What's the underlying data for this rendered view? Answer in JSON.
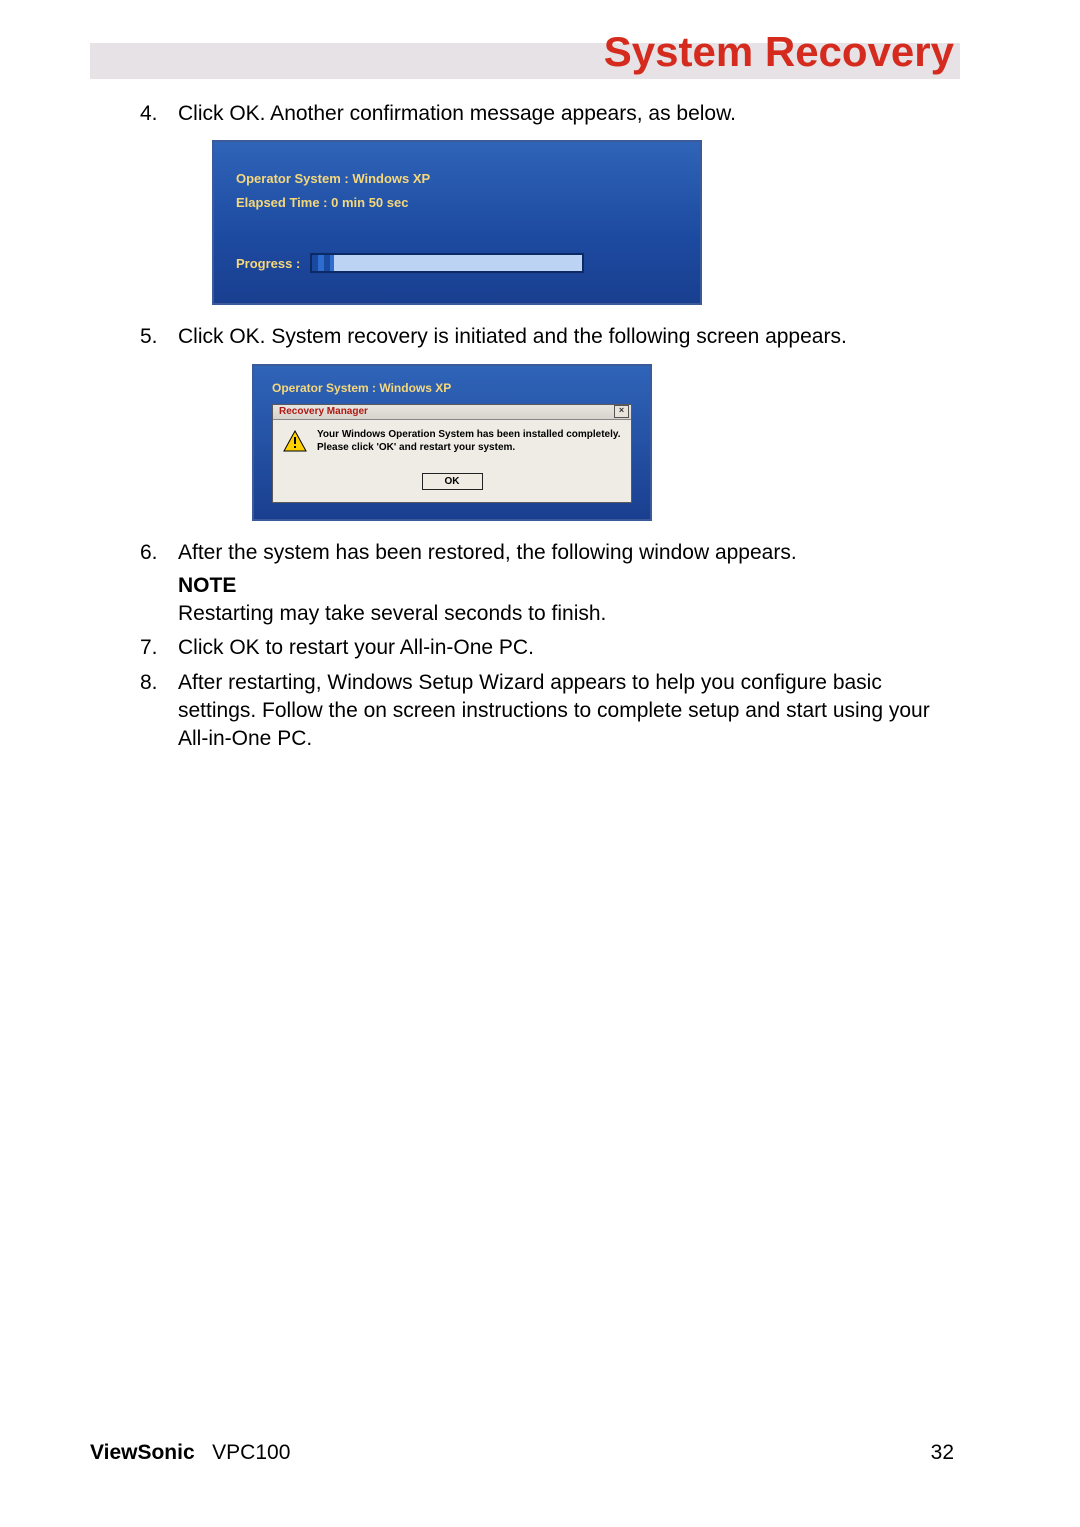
{
  "header": {
    "title": "System Recovery"
  },
  "steps": {
    "s4_num": "4.",
    "s4": "Click OK. Another confirmation message appears, as below.",
    "s5_num": "5.",
    "s5": "Click OK. System recovery is initiated and the following screen appears.",
    "s6_num": "6.",
    "s6": "After the system has been restored, the following window appears.",
    "note_label": "NOTE",
    "note_text": "Restarting may take several seconds to finish.",
    "s7_num": "7.",
    "s7": "Click OK to restart your All-in-One PC.",
    "s8_num": "8.",
    "s8": "After restarting, Windows Setup Wizard appears to help you configure basic settings. Follow the on screen instructions to complete setup and start using your All-in-One PC."
  },
  "shot1": {
    "os_line": "Operator System : Windows XP",
    "elapsed_line": "Elapsed Time :   0 min 50 sec",
    "progress_label": "Progress :"
  },
  "shot2": {
    "os_line": "Operator System : Windows XP",
    "titlebar": "Recovery Manager",
    "close": "×",
    "msg1": "Your Windows Operation System has been installed completely.",
    "msg2": "Please click 'OK' and restart your system.",
    "ok": "OK"
  },
  "footer": {
    "brand": "ViewSonic",
    "model": "VPC100",
    "page": "32"
  }
}
